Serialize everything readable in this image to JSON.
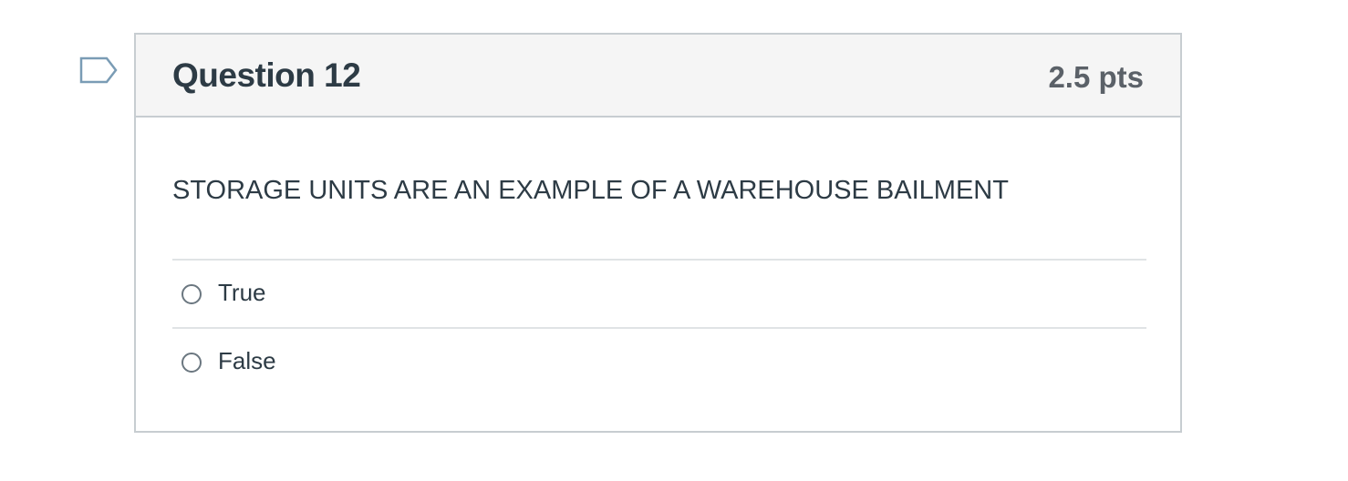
{
  "question": {
    "title": "Question 12",
    "points": "2.5 pts",
    "text": "STORAGE UNITS ARE AN EXAMPLE OF A WAREHOUSE BAILMENT",
    "flag_icon": "flag-bookmark-icon",
    "answers": [
      {
        "label": "True",
        "selected": false
      },
      {
        "label": "False",
        "selected": false
      }
    ]
  },
  "colors": {
    "header_bg": "#f5f5f5",
    "border": "#c7cdd1",
    "text": "#2d3b45",
    "points_text": "#5b6168",
    "flag_stroke": "#7a9cb5"
  }
}
